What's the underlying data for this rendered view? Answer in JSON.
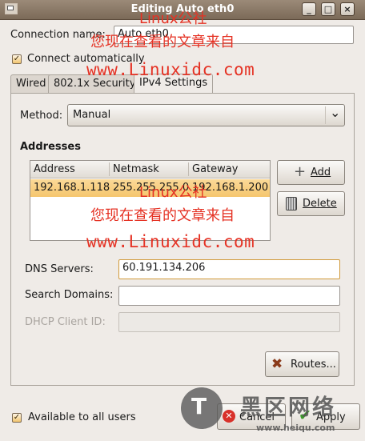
{
  "window": {
    "title": "Editing Auto eth0",
    "controls": {
      "minimize": "_",
      "maximize": "□",
      "close": "×"
    }
  },
  "connection_name": {
    "label": "Connection name:",
    "value": "Auto eth0"
  },
  "connect_automatically": {
    "label": "Connect automatically",
    "checked": true
  },
  "tabs": [
    {
      "label": "Wired"
    },
    {
      "label": "802.1x Security"
    },
    {
      "label": "IPv4 Settings",
      "active": true
    }
  ],
  "method": {
    "label": "Method:",
    "value": "Manual",
    "arrow": "⌄"
  },
  "addresses": {
    "heading": "Addresses",
    "columns": [
      "Address",
      "Netmask",
      "Gateway"
    ],
    "rows": [
      [
        "192.168.1.118",
        "255.255.255.0",
        "192.168.1.200"
      ]
    ],
    "add_label": "Add",
    "delete_label": "Delete"
  },
  "dns_servers": {
    "label": "DNS Servers:",
    "value": "60.191.134.206"
  },
  "search_domains": {
    "label": "Search Domains:",
    "value": ""
  },
  "dhcp_client_id": {
    "label": "DHCP Client ID:",
    "value": ""
  },
  "routes_label": "Routes...",
  "available_all_users": {
    "label": "Available to all users",
    "checked": true
  },
  "cancel_label": "Cancel",
  "apply_label": "Apply",
  "watermark": {
    "line1": "Linux公社",
    "line2": "您现在查看的文章来自",
    "line3": "www.Linuxidc.com",
    "line4": "Linux公社",
    "line5": "您现在查看的文章来自",
    "line6": "www.Linuxidc.com",
    "logo_text": "黑区网络",
    "logo_url": "www.heiqu.com"
  },
  "colors": {
    "accent": "#f5c66e",
    "watermark": "#e53224",
    "titlebar": "#8a7866"
  }
}
